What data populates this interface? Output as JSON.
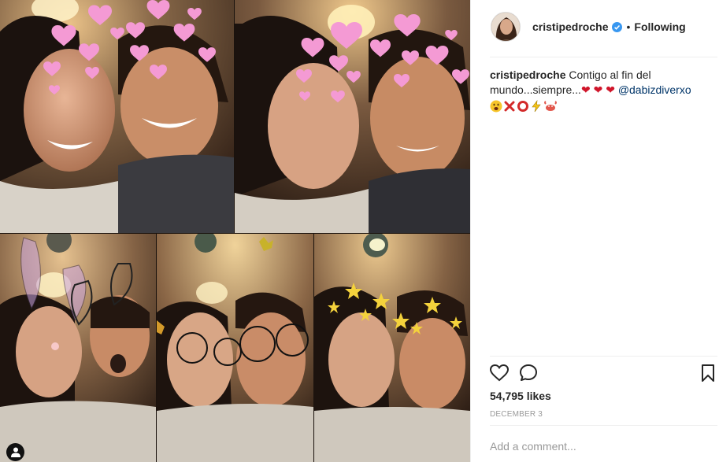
{
  "post": {
    "username": "cristipedroche",
    "verified": true,
    "separator": "•",
    "follow_status": "Following",
    "caption": {
      "username": "cristipedroche",
      "text": "Contigo al fin del mundo...siempre...",
      "hearts": [
        "❤",
        "❤",
        "❤"
      ],
      "mention": "@dabizdiverxo",
      "emojis": [
        "face-icon",
        "cross-mark-icon",
        "ring-icon",
        "lightning-icon",
        "crab-icon"
      ]
    },
    "likes": "54,795 likes",
    "date": "December 3",
    "comment_placeholder": "Add a comment..."
  },
  "colors": {
    "text": "#262626",
    "muted": "#999999",
    "mention": "#003569",
    "verified": "#3897f0",
    "heart": "#ed4956"
  },
  "icons": {
    "like": "heart-outline-icon",
    "comment": "speech-bubble-icon",
    "save": "bookmark-icon",
    "tag": "user-tag-icon"
  }
}
